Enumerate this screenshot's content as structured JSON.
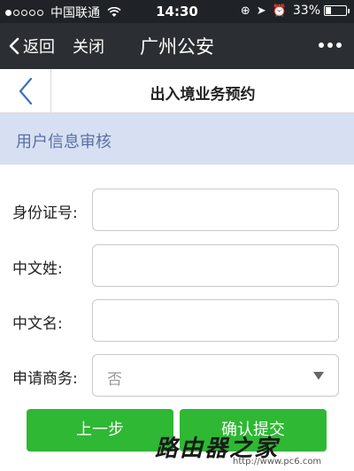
{
  "statusbar": {
    "carrier": "中国联通",
    "time": "14:30",
    "battery": "33%",
    "battery_fraction": 0.33,
    "signal_dots_filled": 1,
    "signal_dots_total": 5
  },
  "navbar": {
    "back_label": "返回",
    "close_label": "关闭",
    "title": "广州公安"
  },
  "subheader": {
    "title": "出入境业务预约"
  },
  "section": {
    "title": "用户信息审核"
  },
  "form": {
    "id_label": "身份证号:",
    "id_value": "",
    "surname_label": "中文姓:",
    "surname_value": "",
    "given_label": "中文名:",
    "given_value": "",
    "business_label": "申请商务:",
    "business_value": "否"
  },
  "buttons": {
    "prev": "上一步",
    "confirm": "确认提交"
  },
  "watermark": {
    "brand": "路由器之家",
    "url": "http://www.pc6.com"
  },
  "colors": {
    "statusbar": "#1f2327",
    "navbar": "#2b2f33",
    "section_bg": "#d7e0f2",
    "section_text": "#5a6fa5",
    "button_green": "#2eb833"
  },
  "icons": [
    "wifi-icon",
    "lock-rotation-icon",
    "location-icon",
    "alarm-icon",
    "battery-icon",
    "chevron-left-icon",
    "more-dots-icon",
    "dropdown-caret-icon"
  ]
}
